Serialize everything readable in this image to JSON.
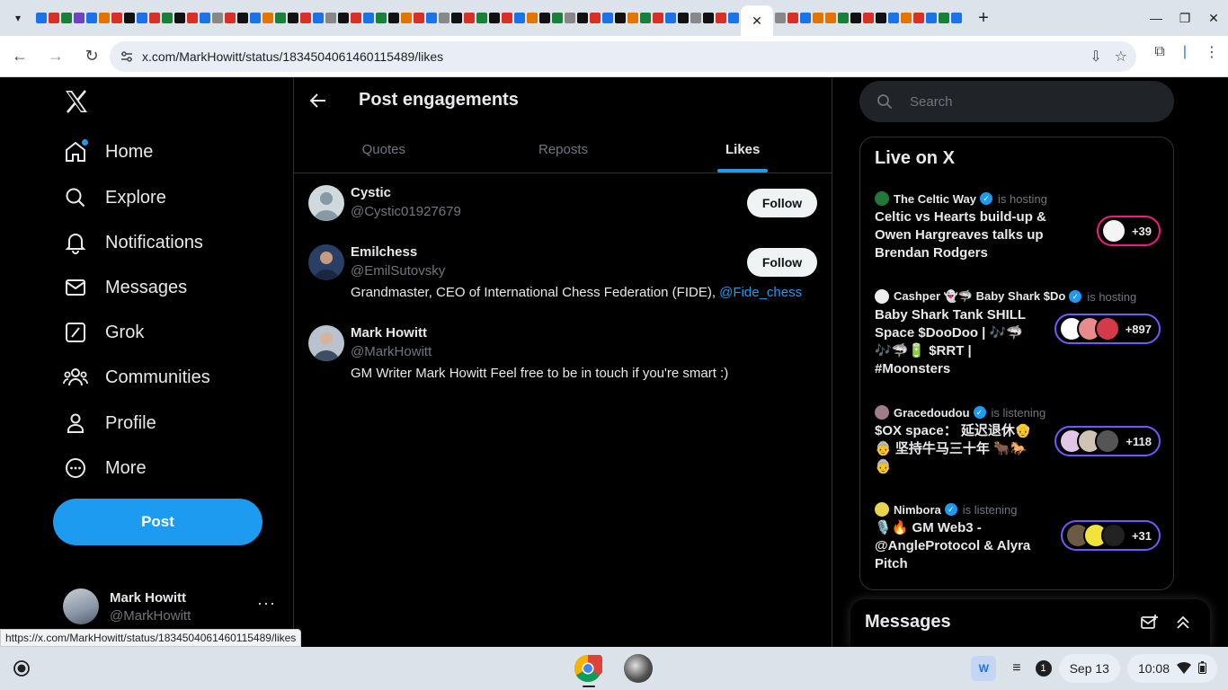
{
  "browser": {
    "url": "x.com/MarkHowitt/status/1834504061460115489/likes",
    "status_url": "https://x.com/MarkHowitt/status/1834504061460115489/likes",
    "new_tab": "+",
    "close_tab": "✕"
  },
  "nav": {
    "items": [
      {
        "label": "Home",
        "icon": "home-icon"
      },
      {
        "label": "Explore",
        "icon": "search-icon"
      },
      {
        "label": "Notifications",
        "icon": "bell-icon"
      },
      {
        "label": "Messages",
        "icon": "envelope-icon"
      },
      {
        "label": "Grok",
        "icon": "grok-icon"
      },
      {
        "label": "Communities",
        "icon": "people-icon"
      },
      {
        "label": "Profile",
        "icon": "person-icon"
      },
      {
        "label": "More",
        "icon": "more-circle-icon"
      }
    ],
    "post_label": "Post",
    "account": {
      "name": "Mark Howitt",
      "handle": "@MarkHowitt",
      "more": "···"
    }
  },
  "main": {
    "title": "Post engagements",
    "tabs": [
      {
        "label": "Quotes",
        "active": false
      },
      {
        "label": "Reposts",
        "active": false
      },
      {
        "label": "Likes",
        "active": true
      }
    ],
    "users": [
      {
        "name": "Cystic",
        "handle": "@Cystic01927679",
        "bio": "",
        "bio_link": "",
        "follow_label": "Follow"
      },
      {
        "name": "Emilchess",
        "handle": "@EmilSutovsky",
        "bio": "Grandmaster, CEO of International Chess Federation (FIDE), ",
        "bio_link": "@Fide_chess",
        "follow_label": "Follow"
      },
      {
        "name": "Mark Howitt",
        "handle": "@MarkHowitt",
        "bio": "GM Writer Mark Howitt Feel free to be in touch if you're smart :)",
        "bio_link": "",
        "follow_label": ""
      }
    ]
  },
  "right": {
    "search_placeholder": "Search",
    "live_title": "Live on X",
    "spaces": [
      {
        "host": "The Celtic Way",
        "status": "is hosting",
        "title": "Celtic vs Hearts build-up & Owen Hargreaves talks up Brendan Rodgers",
        "count": "+39",
        "ring": "#f91880"
      },
      {
        "host": "Cashper 👻🦈 Baby Shark $Do",
        "status": "is hosting",
        "title": "Baby Shark Tank SHILL Space $DooDoo | 🎶🦈🎶🦈🔋 $RRT | #Moonsters",
        "count": "+897",
        "ring": "#7856ff"
      },
      {
        "host": "Gracedoudou",
        "status": "is listening",
        "title": "$OX space： 延迟退休👴👵 坚持牛马三十年 🐂🐎👵",
        "count": "+118",
        "ring": "#7856ff"
      },
      {
        "host": "Nimbora",
        "status": "is listening",
        "title": "🎙️🔥 GM Web3 - @AngleProtocol & Alyra Pitch",
        "count": "+31",
        "ring": "#7856ff"
      }
    ],
    "messages_title": "Messages"
  },
  "shelf": {
    "date": "Sep 13",
    "time": "10:08",
    "notification_count": "1"
  },
  "colors": {
    "accent": "#1d9bf0",
    "background": "#000000",
    "border": "#2f3336",
    "secondary_text": "#71767b"
  }
}
